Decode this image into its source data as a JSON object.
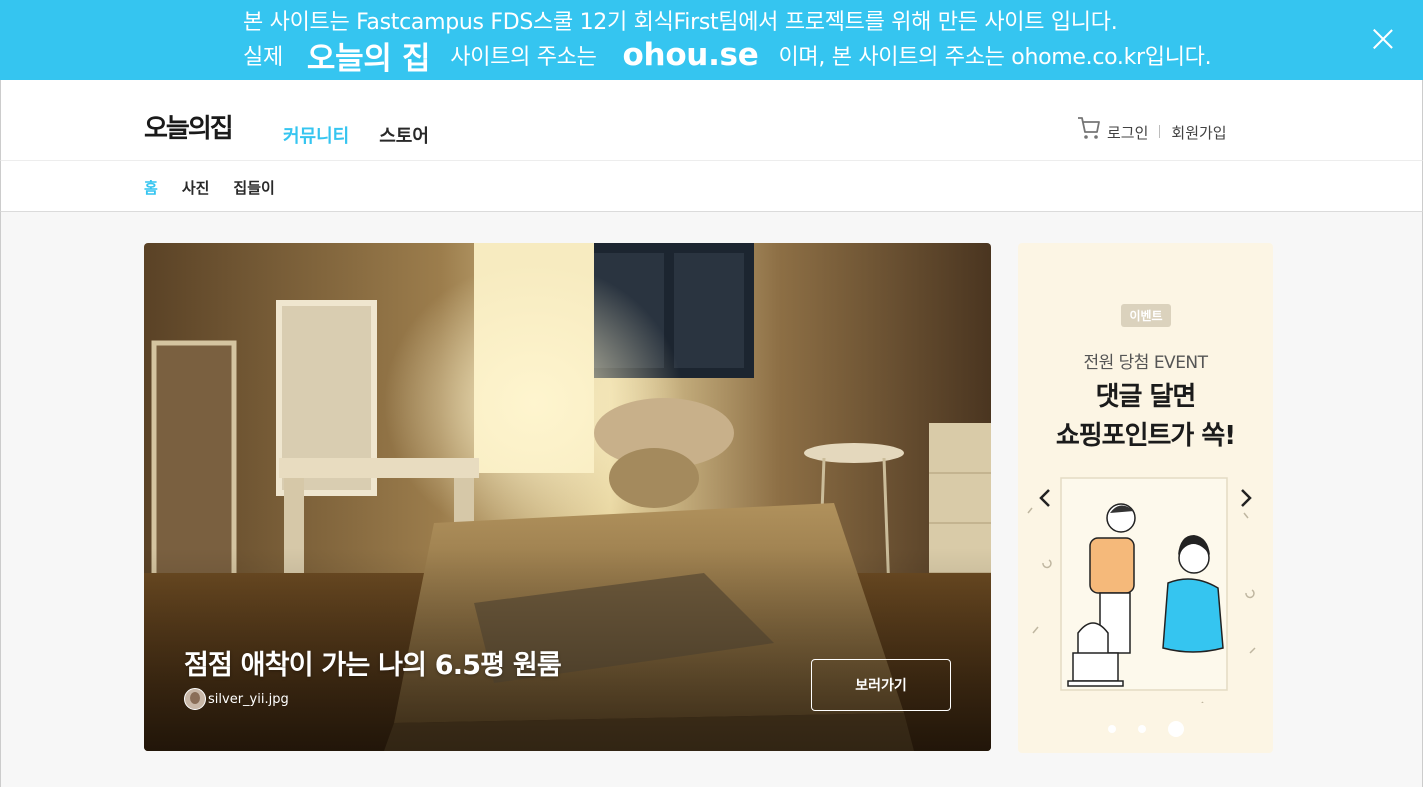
{
  "notice": {
    "line1": "본 사이트는 Fastcampus FDS스쿨 12기 회식First팀에서 프로젝트를 위해 만든 사이트 입니다.",
    "line2_prefix": "실제",
    "line2_brand": "오늘의 집",
    "line2_mid": "사이트의 주소는",
    "line2_url": "ohou.se",
    "line2_suffix": "이며, 본 사이트의 주소는 ohome.co.kr입니다.",
    "close_icon": "close-icon"
  },
  "header": {
    "logo": "오늘의집",
    "nav": [
      {
        "label": "커뮤니티",
        "active": true
      },
      {
        "label": "스토어",
        "active": false
      }
    ],
    "cart_icon": "cart-icon",
    "login": "로그인",
    "signup": "회원가입"
  },
  "subnav": {
    "items": [
      {
        "label": "홈",
        "active": true
      },
      {
        "label": "사진",
        "active": false
      },
      {
        "label": "집들이",
        "active": false
      }
    ]
  },
  "hero": {
    "title": "점점 애착이 가는 나의 6.5평 원룸",
    "author": "silver_yii.jpg",
    "button": "보러가기"
  },
  "event": {
    "badge": "이벤트",
    "subtitle": "전원 당첨 EVENT",
    "headline_line1": "댓글 달면",
    "headline_line2": "쇼핑포인트가 쏙!",
    "prev_icon": "chevron-left-icon",
    "next_icon": "chevron-right-icon",
    "slide_count": 3,
    "active_slide": 3
  },
  "colors": {
    "accent": "#35c5f0",
    "event_bg": "#fcf5e4"
  }
}
